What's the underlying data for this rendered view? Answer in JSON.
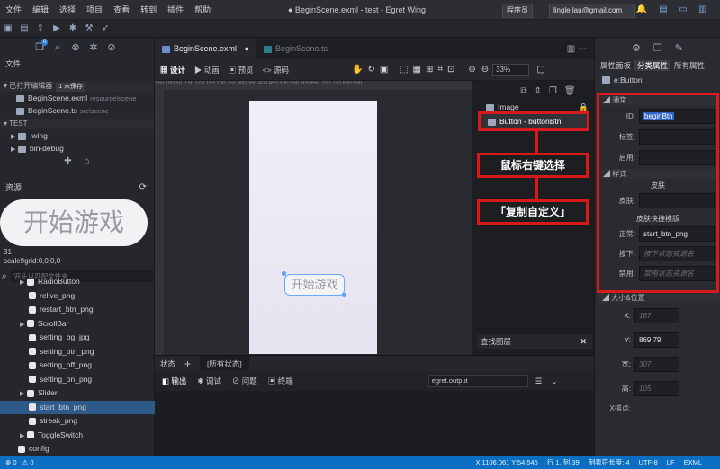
{
  "menu": [
    "文件",
    "编辑",
    "选择",
    "项目",
    "查看",
    "转到",
    "插件",
    "帮助"
  ],
  "window_title": "● BeginScene.exml - test - Egret Wing",
  "header": {
    "role": "程序员",
    "email": "lingle.lau@gmail.com"
  },
  "left_panel": {
    "files_title": "文件",
    "badge_count": "0",
    "open_editors_label": "已打开编辑器",
    "unsaved_badge": "1 未保存",
    "open_files": [
      {
        "name": "BeginScene.exml",
        "path": "resource\\scene"
      },
      {
        "name": "BeginScene.ts",
        "path": "src\\scene"
      }
    ],
    "project_label": "TEST",
    "project_items": [
      ".wing",
      "bin-debug"
    ],
    "resources_label": "资源",
    "preview_text": "开始游戏",
    "preview_info1": "31",
    "preview_info2": "scale9grid:0,0,0,0",
    "search_placeholder": "/开头以匹配文件夹",
    "resource_items": [
      {
        "name": "RadioButton",
        "kind": "folder"
      },
      {
        "name": "relive_png",
        "kind": "image"
      },
      {
        "name": "restart_btn_png",
        "kind": "image"
      },
      {
        "name": "ScrollBar",
        "kind": "folder"
      },
      {
        "name": "setting_bg_jpg",
        "kind": "image"
      },
      {
        "name": "setting_btn_png",
        "kind": "image"
      },
      {
        "name": "setting_off_png",
        "kind": "image"
      },
      {
        "name": "setting_on_png",
        "kind": "image"
      },
      {
        "name": "Slider",
        "kind": "folder"
      },
      {
        "name": "start_btn_png",
        "kind": "image"
      },
      {
        "name": "streak_png",
        "kind": "image"
      },
      {
        "name": "ToggleSwitch",
        "kind": "folder"
      },
      {
        "name": "config",
        "kind": "folder"
      }
    ]
  },
  "editor": {
    "tabs": [
      {
        "label": "BeginScene.exml",
        "active": true
      },
      {
        "label": "BeginScene.ts",
        "active": false
      }
    ],
    "modes": [
      "设计",
      "动画",
      "预览",
      "源码"
    ],
    "zoom": "33%",
    "ruler_marks": "150 100 50 0 50 100 150 200 250 300 350 400 450 500 550 600 650 700 750 800 850",
    "stage_button_text": "开始游戏"
  },
  "layers": {
    "items": [
      "Image",
      "Button - buttonBtn"
    ],
    "annotation1": "鼠标右键选择",
    "annotation2": "「复制自定义」",
    "search_label": "查找图层"
  },
  "state_bar": {
    "label": "状态",
    "all_states": "[所有状态]"
  },
  "output": {
    "tabs": [
      "输出",
      "调试",
      "问题",
      "终端"
    ],
    "channel": "egret.output"
  },
  "properties": {
    "tabs": [
      "属性面板",
      "分类属性",
      "所有属性"
    ],
    "component": "e:Button",
    "section_general": "通常",
    "id_label": "ID:",
    "id_value": "beginBtn",
    "label_label": "标签:",
    "enabled_label": "启用:",
    "section_style": "样式",
    "skin_title": "皮肤",
    "skin_label": "皮肤:",
    "skin_template_title": "皮肤快捷模版",
    "normal_label": "正常:",
    "normal_value": "start_btn_png",
    "down_label": "按下:",
    "down_placeholder": "按下状态资源名",
    "disabled_label": "禁用:",
    "disabled_placeholder": "禁用状态资源名",
    "section_size": "大小&位置",
    "x_label": "X:",
    "x_value": "167",
    "y_label": "Y:",
    "y_value": "869.79",
    "w_label": "宽:",
    "w_value": "307",
    "h_label": "高:",
    "h_value": "105",
    "anchor_label": "X描点:"
  },
  "status_bar": {
    "errors": "0",
    "warnings": "0",
    "coords": "X:1106.061 Y:54.545",
    "position": "行 1, 列 39",
    "tab_size": "制表符长度: 4",
    "encoding": "UTF-8",
    "eol": "LF",
    "language": "EXML"
  },
  "colors": {
    "accent": "#0a6fc2",
    "annotation": "#d71919",
    "selection": "#68a8ff"
  }
}
